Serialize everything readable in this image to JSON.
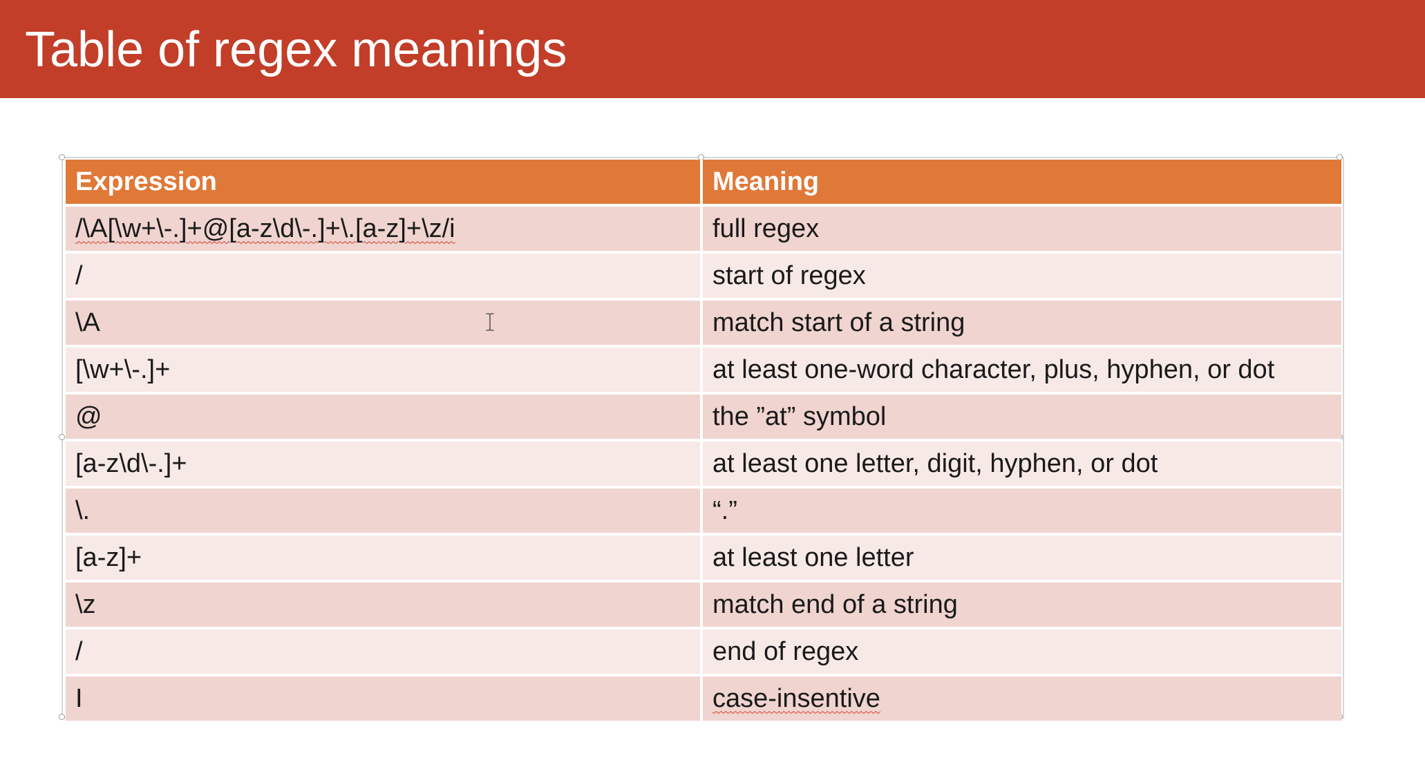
{
  "slide": {
    "title": "Table of regex meanings"
  },
  "table": {
    "headers": [
      "Expression",
      "Meaning"
    ],
    "rows": [
      [
        "/\\A[\\w+\\-.]+@[a-z\\d\\-.]+\\.[a-z]+\\z/i",
        "full regex"
      ],
      [
        "/",
        "start of regex"
      ],
      [
        "\\A",
        "match start of a string"
      ],
      [
        "[\\w+\\-.]+",
        "at least one-word character, plus, hyphen, or dot"
      ],
      [
        "@",
        "the ”at” symbol"
      ],
      [
        "[a-z\\d\\-.]+",
        "at least one letter, digit, hyphen, or dot"
      ],
      [
        "\\.",
        "“.”"
      ],
      [
        "[a-z]+",
        "at least one letter"
      ],
      [
        "\\z",
        "match end of a string"
      ],
      [
        "/",
        "end of regex"
      ],
      [
        "I",
        "case-insentive"
      ]
    ]
  },
  "colors": {
    "title_bar": "#c23e29",
    "header_row": "#e07838",
    "row_dark": "#f0d4cf",
    "row_light": "#f7e9e6",
    "spellcheck_underline": "#d33b2c"
  },
  "icons": {
    "text_cursor": "i-beam-cursor-icon"
  }
}
